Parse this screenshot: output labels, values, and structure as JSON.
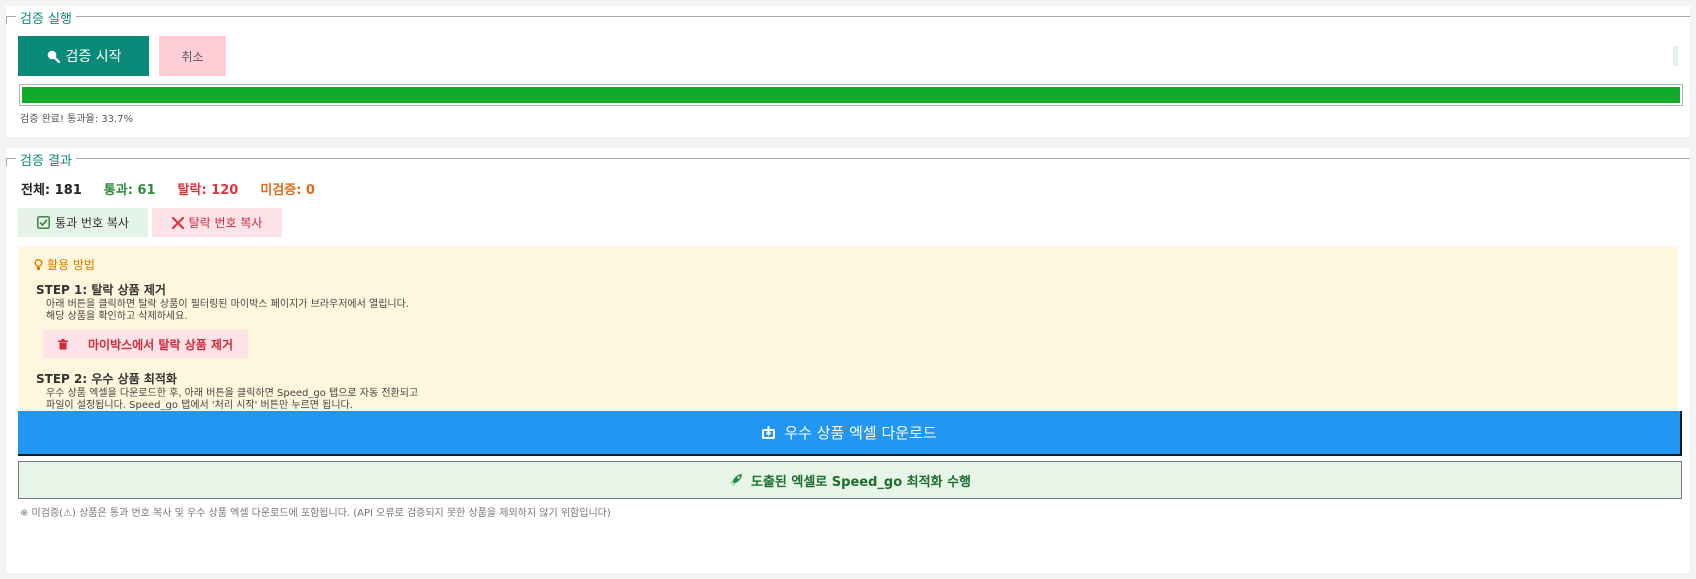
{
  "run_section": {
    "legend": "검증 실행",
    "start_button": {
      "label": "검증 시작",
      "icon": "magnifier-icon"
    },
    "cancel_button": {
      "label": "취소"
    },
    "progress": {
      "percent": 100
    },
    "status_text": "검증 완료! 통과율: 33.7%"
  },
  "result_section": {
    "legend": "검증 결과",
    "stats": {
      "total": "전체: 181",
      "pass": "통과: 61",
      "fail": "탈락: 120",
      "unverified": "미검증: 0"
    },
    "copy_pass_button": {
      "label": "통과 번호 복사",
      "icon": "checkbox-icon"
    },
    "copy_fail_button": {
      "label": "탈락 번호 복사",
      "icon": "x-icon"
    },
    "guide": {
      "title": "활용 방법",
      "step1_title": "STEP 1: 탈락 상품 제거",
      "step1_line1": "아래 버튼을 클릭하면 탈락 상품이 필터링된 마이박스 페이지가 브라우저에서 열립니다.",
      "step1_line2": "해당 상품을 확인하고 삭제하세요.",
      "remove_button": "마이박스에서 탈락 상품 제거",
      "step2_title": "STEP 2: 우수 상품 최적화",
      "step2_line1": "우수 상품 엑셀을 다운로드한 후, 아래 버튼을 클릭하면 Speed_go 탭으로 자동 전환되고",
      "step2_line2": "파일이 설정됩니다. Speed_go 탭에서 '처리 시작' 버튼만 누르면 됩니다."
    },
    "download_button": {
      "label": "우수 상품 엑셀 다운로드",
      "icon": "download-icon"
    },
    "optimize_button": {
      "label": "도출된 엑셀로 Speed_go 최적화 수행",
      "icon": "rocket-icon"
    },
    "footnote": "※ 미검증(⚠) 상품은 통과 번호 복사 및 우수 상품 엑셀 다운로드에 포함됩니다. (API 오류로 검증되지 못한 상품을 제외하지 않기 위함입니다)"
  },
  "colors": {
    "accent": "#0b8a79",
    "progress": "#0fab2a",
    "download": "#2196f3",
    "pass": "#2e8b3d",
    "fail": "#d9363e",
    "unverified": "#e06a1b"
  }
}
